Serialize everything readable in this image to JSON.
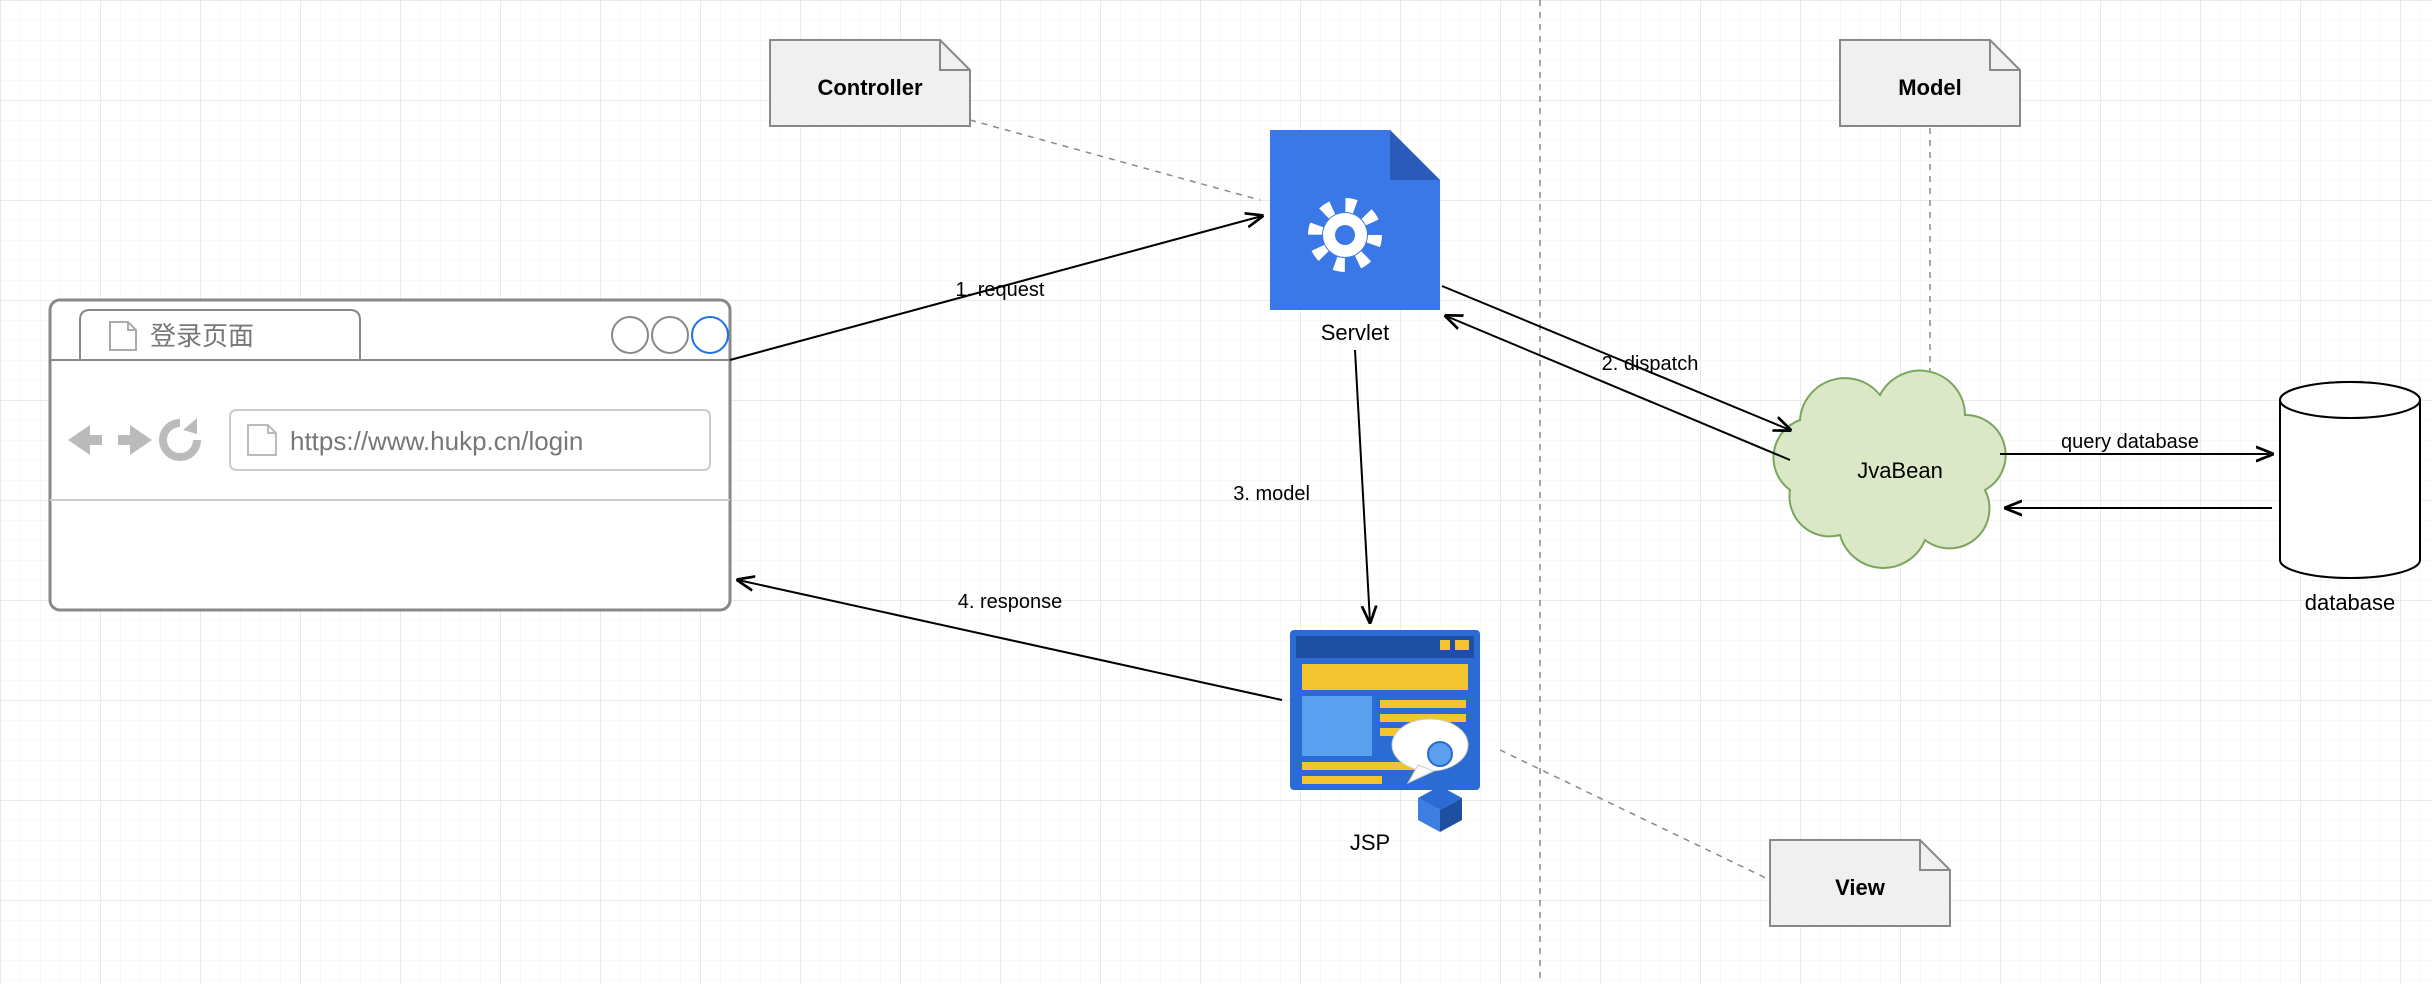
{
  "notes": {
    "controller": "Controller",
    "model": "Model",
    "view": "View"
  },
  "nodes": {
    "servlet": "Servlet",
    "javabean": "JvaBean",
    "database": "database",
    "jsp": "JSP"
  },
  "browser": {
    "tab_title": "登录页面",
    "url": "https://www.hukp.cn/login"
  },
  "edges": {
    "request": "1. request",
    "dispatch": "2. dispatch",
    "model": "3. model",
    "response": "4. response",
    "query": "query database"
  }
}
